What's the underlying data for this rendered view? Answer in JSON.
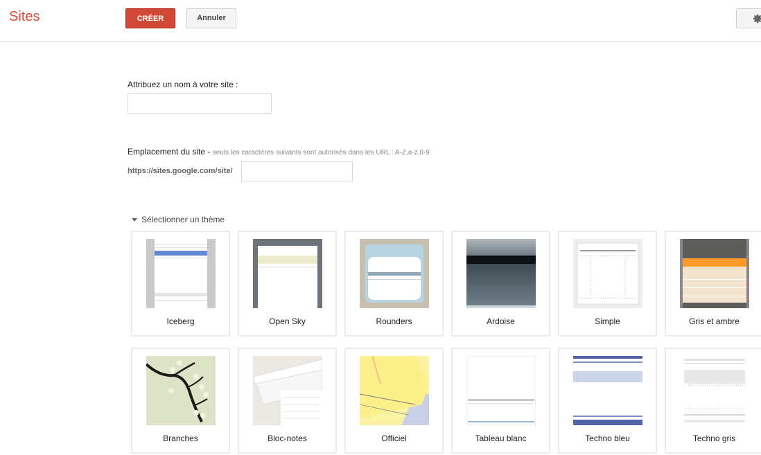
{
  "header": {
    "app_title": "Sites",
    "create_label": "CRÉER",
    "cancel_label": "Annuler",
    "settings_icon": "gear-icon"
  },
  "form": {
    "name_label": "Attribuez un nom à votre site :",
    "name_value": "",
    "location_label": "Emplacement du site",
    "location_separator": "-",
    "location_hint": "seuls les caractères suivants sont autorisés dans les URL : A-Z,a-z,0-9",
    "url_prefix": "https://sites.google.com/site/",
    "url_value": ""
  },
  "themes": {
    "section_label": "Sélectionner un thème",
    "items": [
      {
        "name": "Iceberg"
      },
      {
        "name": "Open Sky"
      },
      {
        "name": "Rounders"
      },
      {
        "name": "Ardoise"
      },
      {
        "name": "Simple"
      },
      {
        "name": "Gris et ambre"
      },
      {
        "name": "Branches"
      },
      {
        "name": "Bloc-notes"
      },
      {
        "name": "Officiel"
      },
      {
        "name": "Tableau blanc"
      },
      {
        "name": "Techno bleu"
      },
      {
        "name": "Techno gris"
      }
    ]
  },
  "colors": {
    "brand_red": "#dd4b39",
    "create_button": "#d14836"
  }
}
